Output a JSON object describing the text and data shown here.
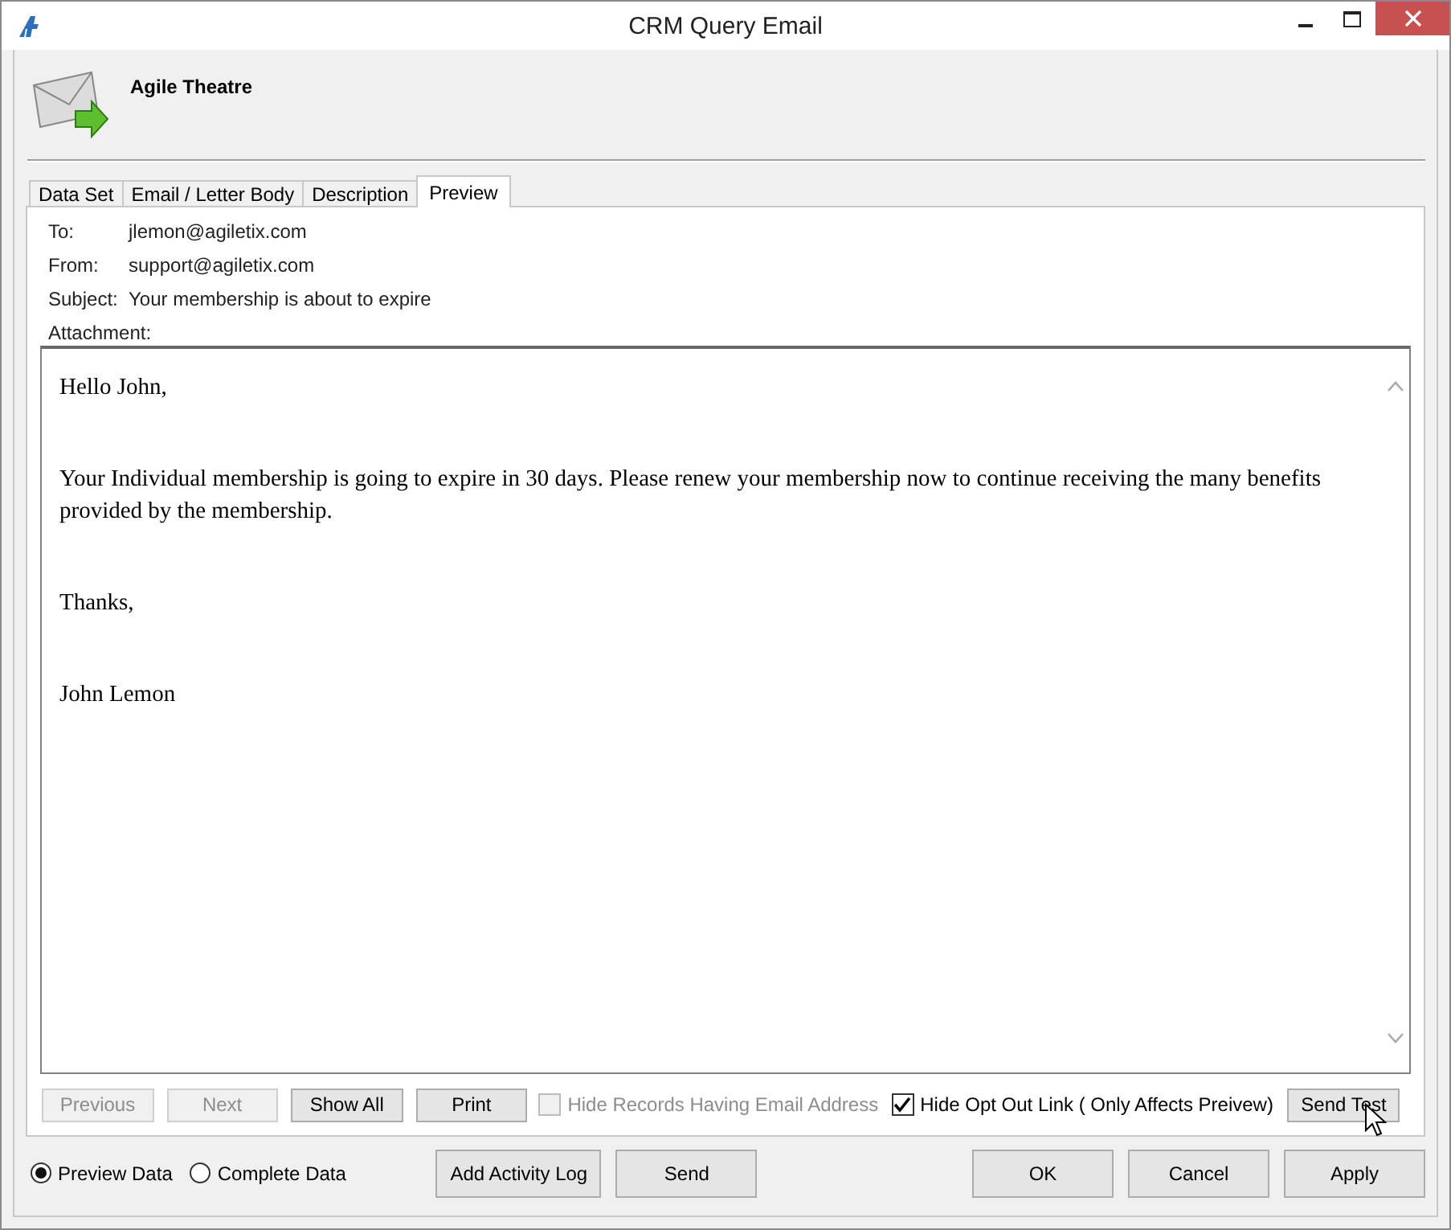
{
  "window": {
    "title": "CRM Query Email"
  },
  "header": {
    "title": "Agile Theatre"
  },
  "tabs": [
    {
      "label": "Data Set",
      "selected": false
    },
    {
      "label": "Email / Letter Body",
      "selected": false
    },
    {
      "label": "Description",
      "selected": false
    },
    {
      "label": "Preview",
      "selected": true
    }
  ],
  "fields": [
    {
      "label": "To:",
      "value": "jlemon@agiletix.com"
    },
    {
      "label": "From:",
      "value": "support@agiletix.com"
    },
    {
      "label": "Subject:",
      "value": "Your membership is about to expire"
    },
    {
      "label": "Attachment:"
    }
  ],
  "body": {
    "paragraphs": [
      "Hello John,",
      "Your Individual membership is going to expire in 30 days.  Please renew your membership now to continue receiving the many benefits provided by the membership.",
      "Thanks,",
      "John Lemon"
    ]
  },
  "nav_buttons": [
    {
      "label": "Previous",
      "disabled": true
    },
    {
      "label": "Next",
      "disabled": true
    },
    {
      "label": "Show All",
      "disabled": false
    },
    {
      "label": "Print",
      "disabled": false
    }
  ],
  "options": [
    {
      "label": "Hide Records Having Email Address",
      "checked": false,
      "disabled": true
    },
    {
      "label": "Hide Opt Out Link ( Only Affects Preivew)",
      "checked": true,
      "disabled": false
    }
  ],
  "send_test": {
    "label": "Send Test"
  },
  "data_mode": [
    {
      "label": "Preview Data",
      "selected": true
    },
    {
      "label": "Complete Data",
      "selected": false
    }
  ],
  "action_buttons": [
    "Add Activity Log",
    "Send"
  ],
  "dialog_buttons": [
    "OK",
    "Cancel",
    "Apply"
  ]
}
